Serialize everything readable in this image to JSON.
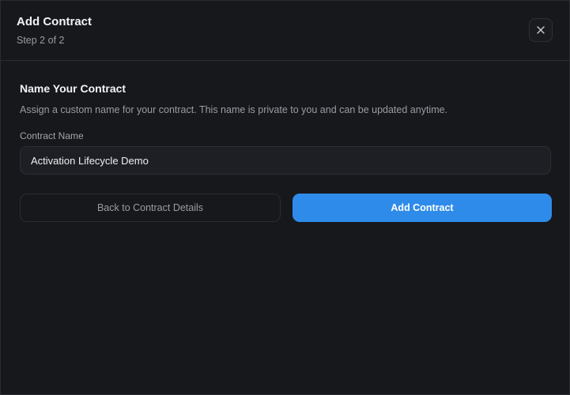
{
  "modal": {
    "title": "Add Contract",
    "step": "Step 2 of 2",
    "close_icon": "close-icon"
  },
  "section": {
    "title": "Name Your Contract",
    "description": "Assign a custom name for your contract. This name is private to you and can be updated anytime."
  },
  "form": {
    "contract_name_label": "Contract Name",
    "contract_name_value": "Activation Lifecycle Demo"
  },
  "actions": {
    "back_label": "Back to Contract Details",
    "submit_label": "Add Contract"
  },
  "colors": {
    "background": "#17181c",
    "primary": "#2f8bea",
    "border": "#2a2c31"
  }
}
